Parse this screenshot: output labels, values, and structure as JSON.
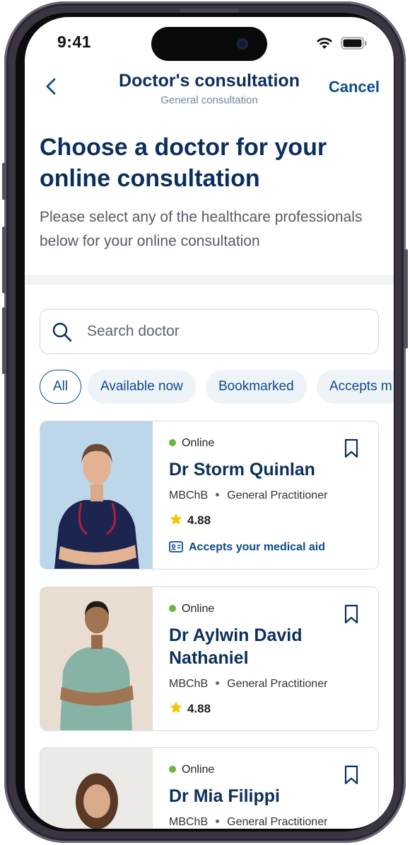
{
  "status_bar": {
    "time": "9:41"
  },
  "nav": {
    "title": "Doctor's consultation",
    "subtitle": "General consultation",
    "cancel_label": "Cancel"
  },
  "page": {
    "heading": "Choose a doctor for your online consultation",
    "intro": "Please select any of the healthcare professionals below for your online consultation"
  },
  "search": {
    "placeholder": "Search doctor",
    "value": ""
  },
  "filters": [
    {
      "label": "All",
      "active": true
    },
    {
      "label": "Available now",
      "active": false
    },
    {
      "label": "Bookmarked",
      "active": false
    },
    {
      "label": "Accepts m",
      "active": false
    }
  ],
  "doctors": [
    {
      "status": "Online",
      "name": "Dr Storm Quinlan",
      "qualification": "MBChB",
      "specialty": "General Practitioner",
      "rating": "4.88",
      "medical_aid": "Accepts your medical aid"
    },
    {
      "status": "Online",
      "name": "Dr Aylwin David Nathaniel",
      "qualification": "MBChB",
      "specialty": "General Practitioner",
      "rating": "4.88"
    },
    {
      "status": "Online",
      "name": "Dr Mia Filippi",
      "qualification": "MBChB",
      "specialty": "General Practitioner"
    }
  ],
  "colors": {
    "brand_navy": "#0b2f5c",
    "link_blue": "#0b4b8c",
    "online_green": "#6cb33f",
    "star_yellow": "#f5c400",
    "chip_bg": "#eef3f8"
  }
}
